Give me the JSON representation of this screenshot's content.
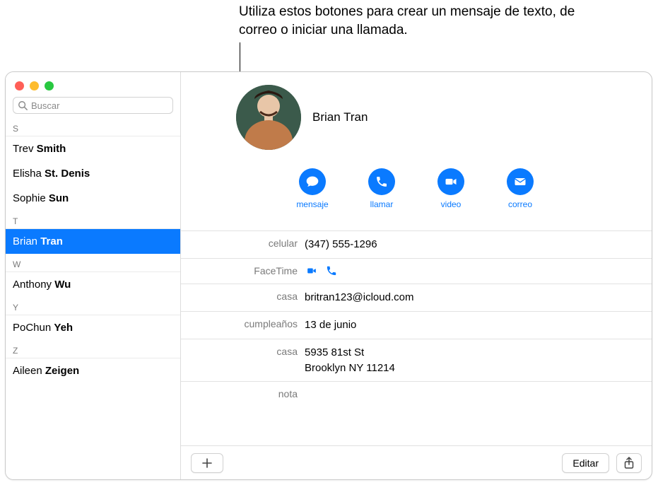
{
  "callout": "Utiliza estos botones para crear un mensaje de texto, de correo o iniciar una llamada.",
  "search": {
    "placeholder": "Buscar"
  },
  "sidebar": {
    "sections": [
      {
        "letter": "S",
        "items": [
          {
            "first": "Trev",
            "last": "Smith"
          },
          {
            "first": "Elisha",
            "last": "St. Denis"
          },
          {
            "first": "Sophie",
            "last": "Sun"
          }
        ]
      },
      {
        "letter": "T",
        "items": [
          {
            "first": "Brian",
            "last": "Tran",
            "selected": true
          }
        ]
      },
      {
        "letter": "W",
        "items": [
          {
            "first": "Anthony",
            "last": "Wu"
          }
        ]
      },
      {
        "letter": "Y",
        "items": [
          {
            "first": "PoChun",
            "last": "Yeh"
          }
        ]
      },
      {
        "letter": "Z",
        "items": [
          {
            "first": "Aileen",
            "last": "Zeigen"
          }
        ]
      }
    ]
  },
  "contact": {
    "name": "Brian Tran",
    "actions": {
      "message": "mensaje",
      "call": "llamar",
      "video": "video",
      "mail": "correo"
    },
    "fields": {
      "mobile_label": "celular",
      "mobile_value": "(347) 555-1296",
      "facetime_label": "FaceTime",
      "home_email_label": "casa",
      "home_email_value": "britran123@icloud.com",
      "birthday_label": "cumpleaños",
      "birthday_value": "13 de junio",
      "home_addr_label": "casa",
      "home_addr_line1": "5935 81st St",
      "home_addr_line2": "Brooklyn NY 11214",
      "note_label": "nota"
    }
  },
  "toolbar": {
    "edit_label": "Editar"
  }
}
